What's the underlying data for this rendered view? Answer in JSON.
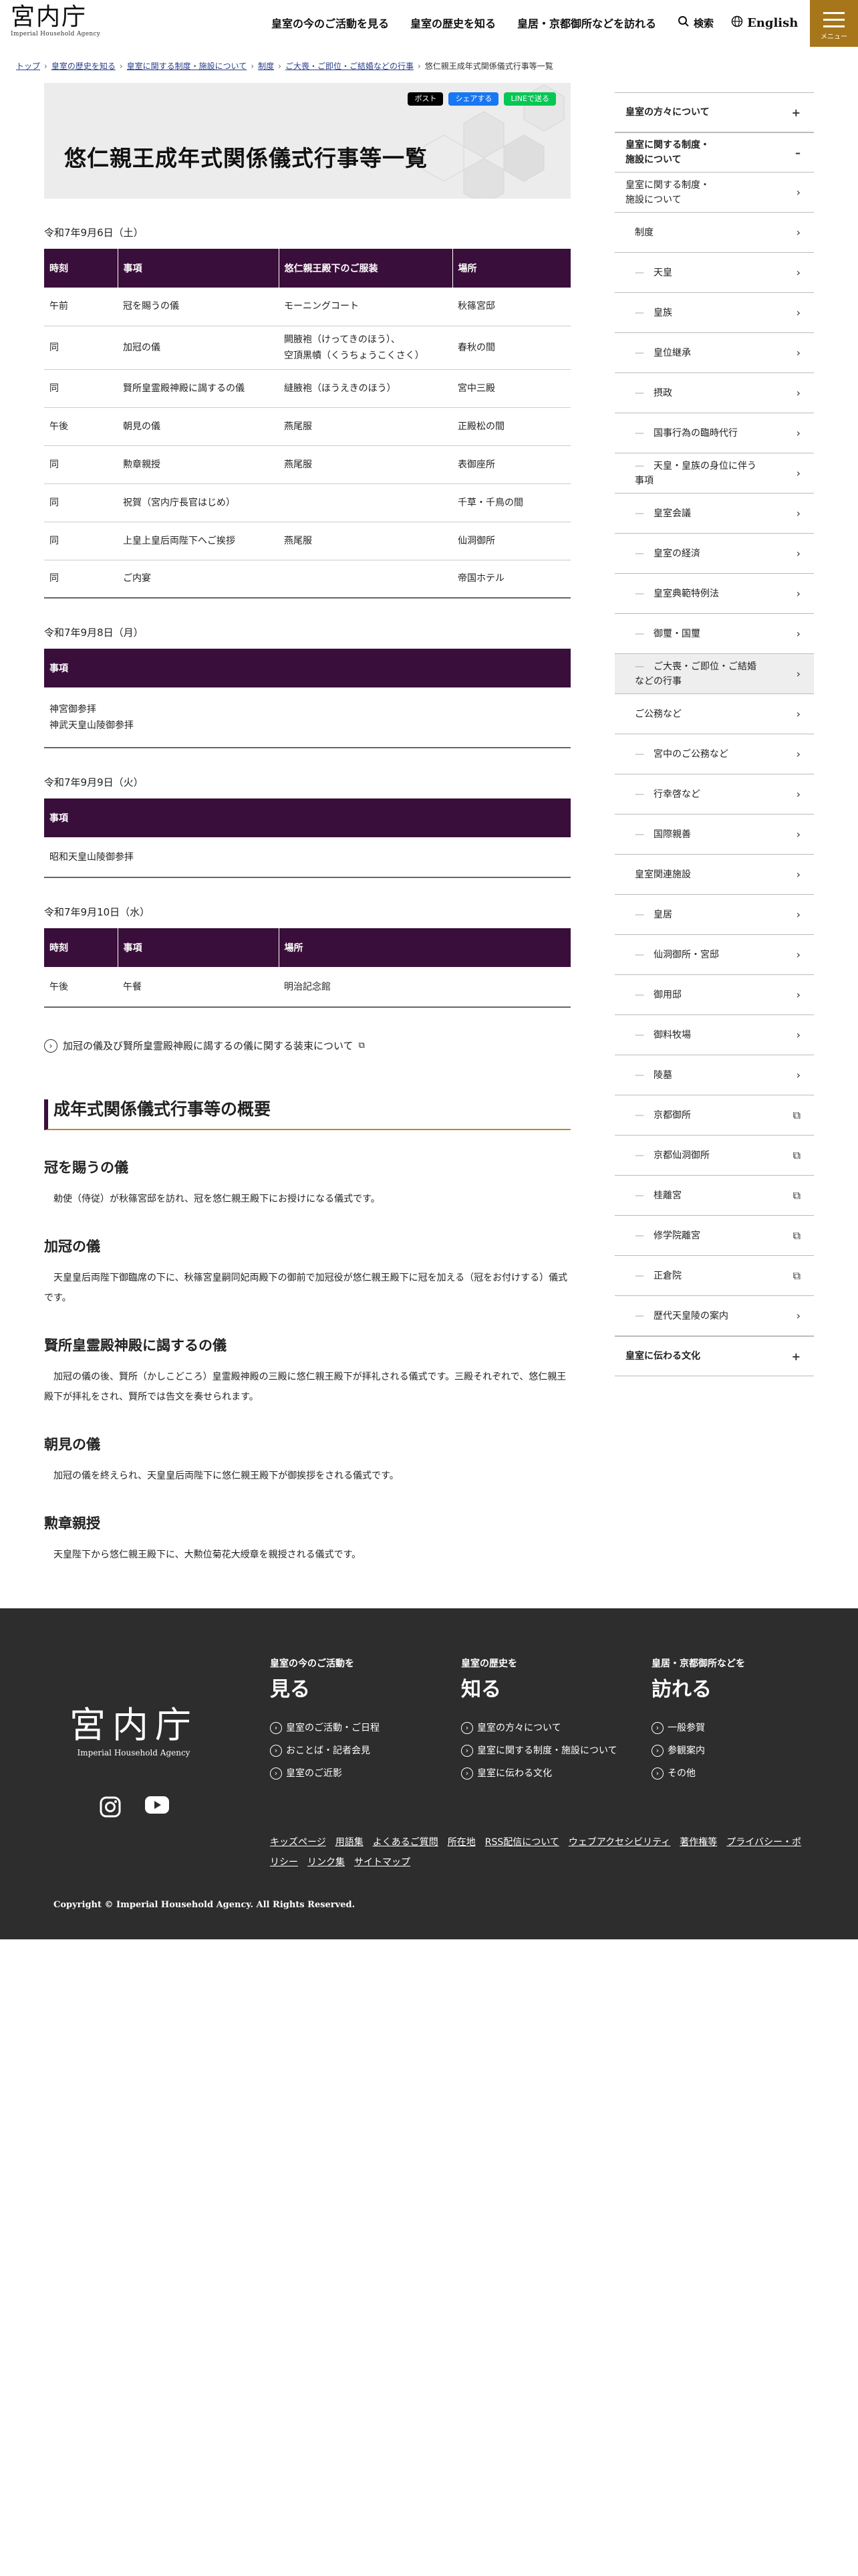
{
  "header": {
    "logo_kanji": "宮内庁",
    "logo_en": "Imperial Household Agency",
    "nav": [
      "皇室の今のご活動を見る",
      "皇室の歴史を知る",
      "皇居・京都御所などを訪れる"
    ],
    "search": "検索",
    "lang": "English",
    "menu": "メニュー"
  },
  "breadcrumb": {
    "items": [
      "トップ",
      "皇室の歴史を知る",
      "皇室に関する制度・施設について",
      "制度",
      "ご大喪・ご即位・ご結婚などの行事"
    ],
    "current": "悠仁親王成年式関係儀式行事等一覧"
  },
  "page": {
    "title": "悠仁親王成年式関係儀式行事等一覧",
    "share": {
      "x": "ポスト",
      "fb": "シェアする",
      "line": "LINEで送る"
    }
  },
  "sections": [
    {
      "date": "令和7年9月6日（土）",
      "headers": [
        "時刻",
        "事項",
        "悠仁親王殿下のご服装",
        "場所"
      ],
      "rows": [
        [
          "午前",
          "冠を賜うの儀",
          "モーニングコート",
          "秋篠宮邸"
        ],
        [
          "同",
          "加冠の儀",
          "闕腋袍（けってきのほう）、\n空頂黒幘（くうちょうこくさく）",
          "春秋の間"
        ],
        [
          "同",
          "賢所皇霊殿神殿に謁するの儀",
          "縫腋袍（ほうえきのほう）",
          "宮中三殿"
        ],
        [
          "午後",
          "朝見の儀",
          "燕尾服",
          "正殿松の間"
        ],
        [
          "同",
          "勲章親授",
          "燕尾服",
          "表御座所"
        ],
        [
          "同",
          "祝賀（宮内庁長官はじめ）",
          "",
          "千草・千鳥の間"
        ],
        [
          "同",
          "上皇上皇后両陛下へご挨拶",
          "燕尾服",
          "仙洞御所"
        ],
        [
          "同",
          "ご内宴",
          "",
          "帝国ホテル"
        ]
      ]
    },
    {
      "date": "令和7年9月8日（月）",
      "headers": [
        "事項"
      ],
      "rows": [
        [
          "神宮御参拝\n神武天皇山陵御参拝"
        ]
      ]
    },
    {
      "date": "令和7年9月9日（火）",
      "headers": [
        "事項"
      ],
      "rows": [
        [
          "昭和天皇山陵御参拝"
        ]
      ]
    },
    {
      "date": "令和7年9月10日（水）",
      "headers": [
        "時刻",
        "事項",
        "場所"
      ],
      "rows": [
        [
          "午後",
          "午餐",
          "明治記念館"
        ]
      ]
    }
  ],
  "related_link": "加冠の儀及び賢所皇霊殿神殿に謁するの儀に関する装束について",
  "overview": {
    "heading": "成年式関係儀式行事等の概要",
    "items": [
      {
        "title": "冠を賜うの儀",
        "text": "勅使（侍従）が秋篠宮邸を訪れ、冠を悠仁親王殿下にお授けになる儀式です。"
      },
      {
        "title": "加冠の儀",
        "text": "天皇皇后両陛下御臨席の下に、秋篠宮皇嗣同妃両殿下の御前で加冠役が悠仁親王殿下に冠を加える（冠をお付けする）儀式です。"
      },
      {
        "title": "賢所皇霊殿神殿に謁するの儀",
        "text": "加冠の儀の後、賢所（かしこどころ）皇霊殿神殿の三殿に悠仁親王殿下が拝礼される儀式です。三殿それぞれで、悠仁親王殿下が拝礼をされ、賢所では告文を奏せられます。"
      },
      {
        "title": "朝見の儀",
        "text": "加冠の儀を終えられ、天皇皇后両陛下に悠仁親王殿下が御挨拶をされる儀式です。"
      },
      {
        "title": "勲章親授",
        "text": "天皇陛下から悠仁親王殿下に、大勲位菊花大綬章を親授される儀式です。"
      }
    ]
  },
  "sidebar": [
    {
      "label": "皇室の方々について",
      "level": "top",
      "icon": "+"
    },
    {
      "label": "皇室に関する制度・\n施設について",
      "level": "top",
      "icon": "–"
    },
    {
      "label": "皇室に関する制度・\n施設について",
      "level": "l2",
      "icon": "›"
    },
    {
      "label": "制度",
      "level": "l3",
      "icon": "›"
    },
    {
      "label": "天皇",
      "level": "l4",
      "icon": "›"
    },
    {
      "label": "皇族",
      "level": "l4",
      "icon": "›"
    },
    {
      "label": "皇位継承",
      "level": "l4",
      "icon": "›"
    },
    {
      "label": "摂政",
      "level": "l4",
      "icon": "›"
    },
    {
      "label": "国事行為の臨時代行",
      "level": "l4",
      "icon": "›"
    },
    {
      "label": "天皇・皇族の身位に伴う\n事項",
      "level": "l4",
      "icon": "›"
    },
    {
      "label": "皇室会議",
      "level": "l4",
      "icon": "›"
    },
    {
      "label": "皇室の経済",
      "level": "l4",
      "icon": "›"
    },
    {
      "label": "皇室典範特例法",
      "level": "l4",
      "icon": "›"
    },
    {
      "label": "御璽・国璽",
      "level": "l4",
      "icon": "›"
    },
    {
      "label": "ご大喪・ご即位・ご結婚\nなどの行事",
      "level": "l4 cur",
      "icon": "›"
    },
    {
      "label": "ご公務など",
      "level": "l3",
      "icon": "›"
    },
    {
      "label": "宮中のご公務など",
      "level": "l4",
      "icon": "›"
    },
    {
      "label": "行幸啓など",
      "level": "l4",
      "icon": "›"
    },
    {
      "label": "国際親善",
      "level": "l4",
      "icon": "›"
    },
    {
      "label": "皇室関連施設",
      "level": "l3",
      "icon": "›"
    },
    {
      "label": "皇居",
      "level": "l4",
      "icon": "›"
    },
    {
      "label": "仙洞御所・宮邸",
      "level": "l4",
      "icon": "›"
    },
    {
      "label": "御用邸",
      "level": "l4",
      "icon": "›"
    },
    {
      "label": "御料牧場",
      "level": "l4",
      "icon": "›"
    },
    {
      "label": "陵墓",
      "level": "l4",
      "icon": "›"
    },
    {
      "label": "京都御所",
      "level": "l4",
      "icon": "⧉"
    },
    {
      "label": "京都仙洞御所",
      "level": "l4",
      "icon": "⧉"
    },
    {
      "label": "桂離宮",
      "level": "l4",
      "icon": "⧉"
    },
    {
      "label": "修学院離宮",
      "level": "l4",
      "icon": "⧉"
    },
    {
      "label": "正倉院",
      "level": "l4",
      "icon": "⧉"
    },
    {
      "label": "歴代天皇陵の案内",
      "level": "l4",
      "icon": "›"
    },
    {
      "label": "皇室に伝わる文化",
      "level": "top",
      "icon": "+"
    }
  ],
  "footer": {
    "logo_kanji": "宮内庁",
    "logo_en": "Imperial Household Agency",
    "cols": [
      {
        "small": "皇室の今のご活動を",
        "large": "見る",
        "links": [
          "皇室のご活動・ご日程",
          "おことば・記者会見",
          "皇室のご近影"
        ]
      },
      {
        "small": "皇室の歴史を",
        "large": "知る",
        "links": [
          "皇室の方々について",
          "皇室に関する制度・施設について",
          "皇室に伝わる文化"
        ]
      },
      {
        "small": "皇居・京都御所などを",
        "large": "訪れる",
        "links": [
          "一般参賀",
          "参観案内",
          "その他"
        ]
      }
    ],
    "links": [
      "キッズページ",
      "用語集",
      "よくあるご質問",
      "所在地",
      "RSS配信について",
      "ウェブアクセシビリティ",
      "著作権等",
      "プライバシー・ポリシー",
      "リンク集",
      "サイトマップ"
    ],
    "copyright": "Copyright © Imperial Household Agency. All Rights Reserved."
  }
}
